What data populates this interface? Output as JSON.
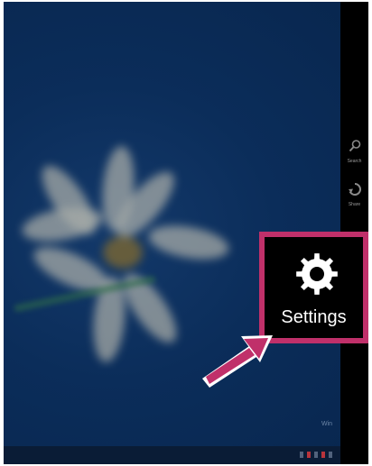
{
  "charms": {
    "search": {
      "label": "Search",
      "icon": "search-icon"
    },
    "share": {
      "label": "Share",
      "icon": "share-icon"
    },
    "settings": {
      "label": "Settings",
      "icon": "gear-icon"
    }
  },
  "colors": {
    "highlight": "#c0306a",
    "charms_bg": "#000000",
    "desktop": "#0b2d5a"
  }
}
